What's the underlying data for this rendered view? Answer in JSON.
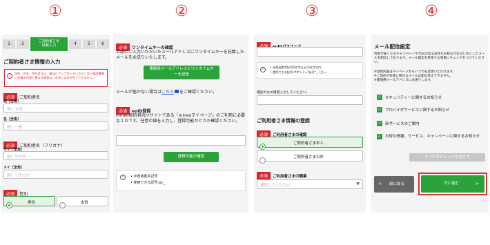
{
  "step_numbers": [
    "①",
    "②",
    "③",
    "④"
  ],
  "panel1": {
    "steps": [
      "1",
      "2",
      "ご契約者さま\n情報入力",
      "4",
      "5",
      "6"
    ],
    "title": "ご契約者さま情報の入力",
    "alert": "住所、氏名、生年月日は、後ほどアップロードいただく本人確認書類に記載の内容と異なる場合は、お申し込みを完了できません。",
    "required": "必須",
    "name_label": "ご契約者名",
    "sei_label": "姓［全角］",
    "sei_placeholder": "例）山田",
    "mei_label": "名［全角］",
    "mei_placeholder": "例）一郎",
    "kana_label": "ご契約者名（フリガナ）",
    "sei_kana_label": "セイ［全角］",
    "sei_kana_placeholder": "例）ヤマダ",
    "mei_kana_label": "メイ［全角］",
    "mei_kana_placeholder": "例）イチロウ",
    "gender_label": "性別",
    "male": "男性",
    "female": "女性"
  },
  "panel2": {
    "required": "必須",
    "otp_title": "ワンタイムキーの確認",
    "otp_desc": "上記にご入力いただいたメールアドレスにワンタイムキーを記載したメールをお送りいたします。",
    "send_button": "連絡用メールアドレスにワンタイムキーを送信",
    "not_received_prefix": "メールが届かない場合は",
    "here_link": "こちら",
    "not_received_suffix": "をご確認ください。",
    "eoid_title": "eoID登録",
    "eoid_desc": "mineo契約者向けサイトである「mineoマイページ」のご利用に必要なＩＤです。任意の値を入力し、登録可能かどうか確認ください。",
    "check_button": "登録可能か確認",
    "notes": [
      "半角英数字記号",
      "使用できる記号:@-_"
    ]
  },
  "panel3": {
    "required": "必須",
    "pw_title": "eoIDパスワード",
    "notes": [
      "半角英数字記号6文字以上16文字以内",
      "使用できる記号!#$*+./:=?@[]^_`{|}~-"
    ],
    "confirm_label": "確認のため再度入力してください。",
    "user_section_title": "ご利用者さま情報の登録",
    "user_confirm_label": "ご利用者さまの確認",
    "option_self": "ご契約者さま本人",
    "option_other": "ご契約者さま以外",
    "job_label": "ご利用者さまの職業",
    "job_placeholder": "選択してください"
  },
  "panel4": {
    "title": "メール配信設定",
    "desc": "料金が安くなるキャンペーンや元気の出るお得なお知らせをはじめとしたメールを配信しております。メール配信を希望する項目にチェックをつけてください。",
    "notes": [
      "※登録内容はマイページからいつでも変更いただけます。",
      "※ご契約や料金に関わるメールは配信停止できません。",
      "※連絡用メールアドレスにお送りします。"
    ],
    "checks": [
      "セキュリティーに関するお知らせ",
      "プロバイダサービスに関するお知らせ",
      "新サービスのご案内",
      "お得な情報、サービス、キャンペーンに関するお知らせ"
    ],
    "uncheck_all": "すべてのチェックをはずす",
    "back_button": "前に戻る",
    "next_button": "次に進む"
  },
  "colors": {
    "red": "#d6262d",
    "green": "#2aa33a",
    "panel_bg": "#f4f4f4"
  }
}
